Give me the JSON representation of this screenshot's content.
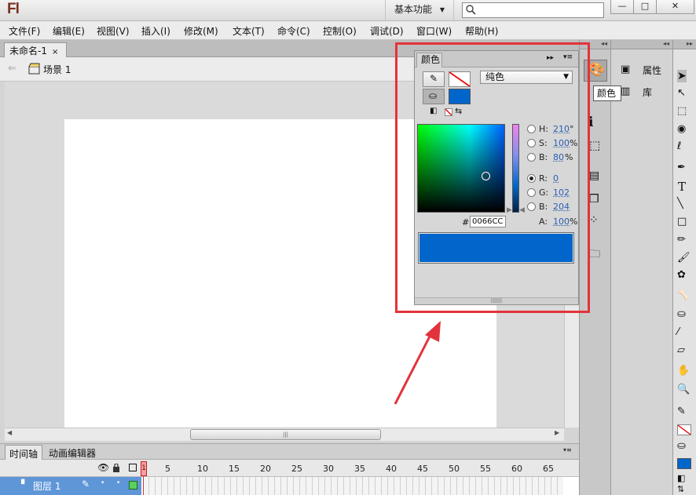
{
  "titlebar": {
    "logo": "Fl",
    "workspace": "基本功能",
    "search_placeholder": "",
    "min_glyph": "—",
    "max_glyph": "□",
    "close_glyph": "✕"
  },
  "menu": [
    "文件(F)",
    "编辑(E)",
    "视图(V)",
    "插入(I)",
    "修改(M)",
    "文本(T)",
    "命令(C)",
    "控制(O)",
    "调试(D)",
    "窗口(W)",
    "帮助(H)"
  ],
  "document": {
    "tab": "未命名-1",
    "tab_close": "×",
    "scene": "场景 1"
  },
  "timeline": {
    "tabs": [
      "时间轴",
      "动画编辑器"
    ],
    "frame_numbers": [
      "1",
      "5",
      "10",
      "15",
      "20",
      "25",
      "30",
      "35",
      "40",
      "45",
      "50",
      "55",
      "60",
      "65"
    ],
    "current_frame": "1",
    "layer_name": "图层 1"
  },
  "color_panel": {
    "tab": "颜色",
    "fill_type": "纯色",
    "hex_prefix": "#",
    "hex": "0066CC",
    "fill_color": "#0066cc",
    "hsb": [
      {
        "label": "H:",
        "value": "210",
        "unit": "°"
      },
      {
        "label": "S:",
        "value": "100",
        "unit": "%"
      },
      {
        "label": "B:",
        "value": "80",
        "unit": "%"
      }
    ],
    "rgb": [
      {
        "label": "R:",
        "value": "0",
        "unit": ""
      },
      {
        "label": "G:",
        "value": "102",
        "unit": ""
      },
      {
        "label": "B:",
        "value": "204",
        "unit": ""
      }
    ],
    "alpha": {
      "label": "A:",
      "value": "100",
      "unit": "%"
    },
    "selected_channel": "R:"
  },
  "dock": {
    "props_items": [
      "属性",
      "库"
    ],
    "tooltip": "颜色"
  },
  "annotation_color": "#e3333a"
}
